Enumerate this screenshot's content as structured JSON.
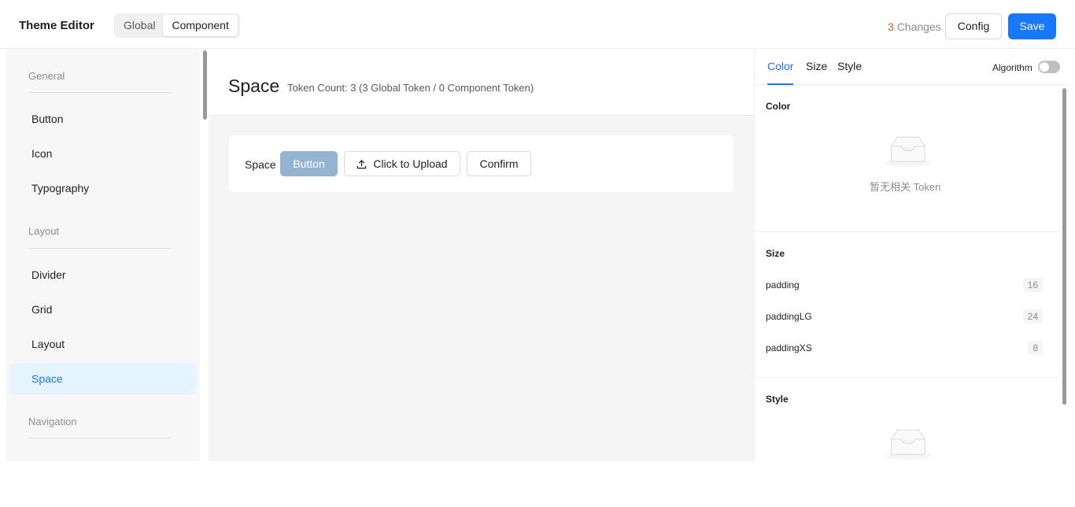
{
  "header": {
    "title": "Theme Editor",
    "segments": [
      "Global",
      "Component"
    ],
    "active_segment": "Component",
    "changes_count": "3",
    "changes_label": "Changes",
    "config_label": "Config",
    "save_label": "Save"
  },
  "sidebar": {
    "groups": [
      {
        "label": "General",
        "items": [
          "Button",
          "Icon",
          "Typography"
        ]
      },
      {
        "label": "Layout",
        "items": [
          "Divider",
          "Grid",
          "Layout",
          "Space"
        ]
      },
      {
        "label": "Navigation",
        "items": []
      }
    ],
    "active_item": "Space"
  },
  "main": {
    "title": "Space",
    "token_count": "Token Count: 3 (3 Global Token / 0 Component Token)",
    "preview": {
      "label": "Space",
      "primary_button": "Button",
      "upload_button": "Click to Upload",
      "confirm_button": "Confirm"
    }
  },
  "panel": {
    "tabs": [
      "Color",
      "Size",
      "Style"
    ],
    "active_tab": "Color",
    "algorithm_label": "Algorithm",
    "algorithm_on": false,
    "color_section": {
      "title": "Color",
      "empty_text": "暂无相关 Token"
    },
    "size_section": {
      "title": "Size",
      "tokens": [
        {
          "name": "padding",
          "value": "16"
        },
        {
          "name": "paddingLG",
          "value": "24"
        },
        {
          "name": "paddingXS",
          "value": "8"
        }
      ]
    },
    "style_section": {
      "title": "Style"
    }
  },
  "colors": {
    "primary": "#1677ff",
    "changes_accent": "#e8590c",
    "active_item_bg": "#e6f4ff"
  }
}
